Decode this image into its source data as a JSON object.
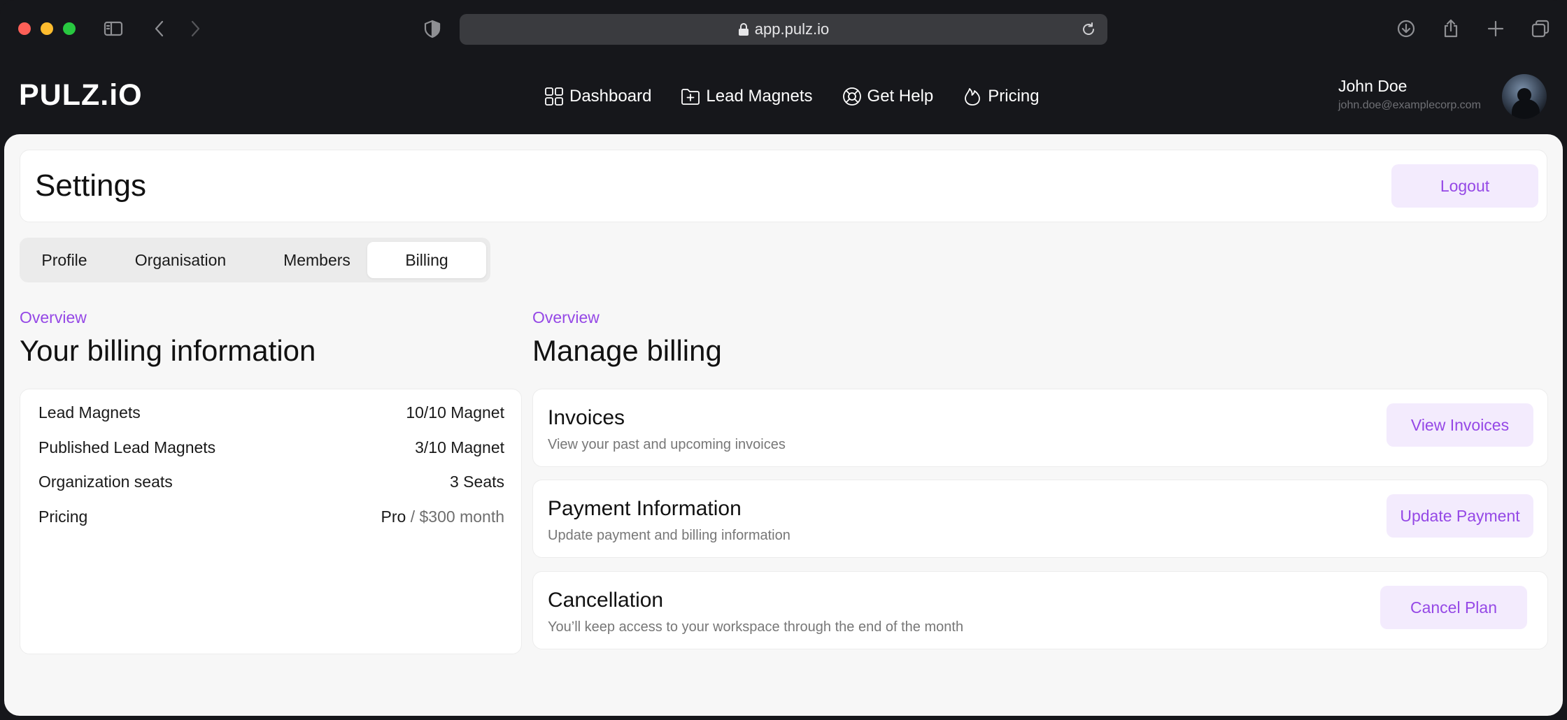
{
  "browser": {
    "url": "app.pulz.io",
    "icons": [
      "sidebar-icon",
      "back-icon",
      "forward-icon",
      "shield-icon",
      "lock-icon",
      "reload-icon",
      "download-icon",
      "share-icon",
      "new-tab-icon",
      "tabs-overview-icon"
    ]
  },
  "header": {
    "logo": "PULZ.iO",
    "nav": [
      {
        "label": "Dashboard",
        "icon": "grid-icon"
      },
      {
        "label": "Lead Magnets",
        "icon": "folder-plus-icon"
      },
      {
        "label": "Get Help",
        "icon": "lifebuoy-icon"
      },
      {
        "label": "Pricing",
        "icon": "flame-icon"
      }
    ],
    "user": {
      "name": "John Doe",
      "email": "john.doe@examplecorp.com"
    }
  },
  "settings": {
    "title": "Settings",
    "logout_label": "Logout",
    "tabs": [
      {
        "label": "Profile",
        "active": false
      },
      {
        "label": "Organisation",
        "active": false
      },
      {
        "label": "Members",
        "active": false
      },
      {
        "label": "Billing",
        "active": true
      }
    ]
  },
  "billing_info": {
    "eyebrow": "Overview",
    "title": "Your billing information",
    "rows": [
      {
        "label": "Lead Magnets",
        "value": "10/10 Magnet"
      },
      {
        "label": "Published Lead Magnets",
        "value": "3/10 Magnet"
      },
      {
        "label": "Organization seats",
        "value": "3 Seats"
      },
      {
        "label": "Pricing",
        "value": "Pro",
        "value_suffix": " / $300 month"
      }
    ]
  },
  "manage_billing": {
    "eyebrow": "Overview",
    "title": "Manage billing",
    "items": [
      {
        "title": "Invoices",
        "subtitle": "View your past and upcoming invoices",
        "button": "View Invoices"
      },
      {
        "title": "Payment Information",
        "subtitle": "Update payment and billing information",
        "button": "Update Payment"
      },
      {
        "title": "Cancellation",
        "subtitle": "You’ll keep access to your workspace through the end of the month",
        "button": "Cancel Plan"
      }
    ]
  },
  "colors": {
    "accent": "#9548e6",
    "accent_soft_bg": "#f3ebfd",
    "chrome_bg": "#16171b",
    "content_bg": "#f7f7f7"
  }
}
